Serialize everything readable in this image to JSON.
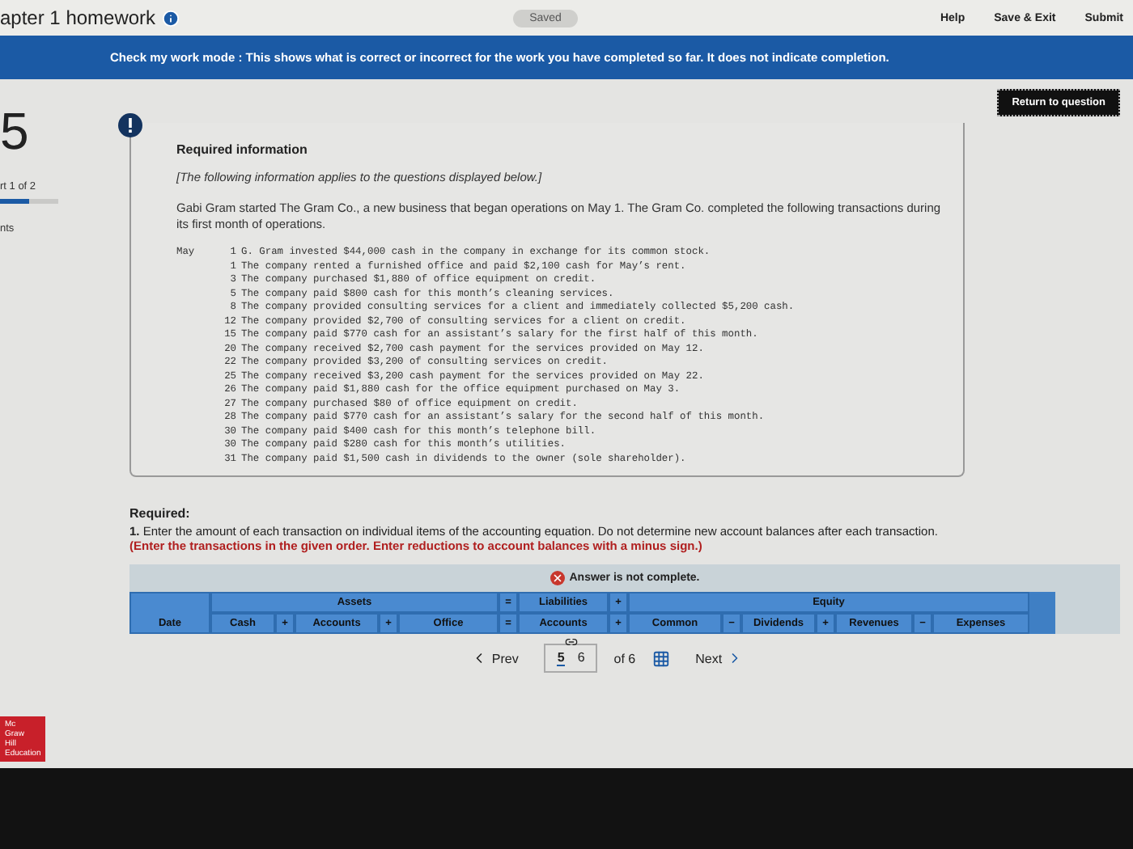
{
  "top_bar": {
    "title": "apter 1 homework",
    "status": "Saved",
    "links": [
      "Help",
      "Save & Exit",
      "Submit"
    ]
  },
  "banner": {
    "label": "Check my work mode :",
    "text": "This shows what is correct or incorrect for the work you have completed so far. It does not indicate completion."
  },
  "sidebar": {
    "question_number": "5",
    "part": "rt 1 of 2",
    "progress": {
      "level": 0.5
    },
    "points": "nts"
  },
  "return_button": "Return to question",
  "required_info": {
    "title": "Required information",
    "note": "[The following information applies to the questions displayed below.]",
    "intro": "Gabi Gram started The Gram Co., a new business that began operations on May 1. The Gram Co. completed the following transactions during its first month of operations.",
    "month": "May",
    "transactions": [
      {
        "day": "1",
        "text": "G. Gram invested $44,000 cash in the company in exchange for its common stock."
      },
      {
        "day": "1",
        "text": "The company rented a furnished office and paid $2,100 cash for May’s rent."
      },
      {
        "day": "3",
        "text": "The company purchased $1,880 of office equipment on credit."
      },
      {
        "day": "5",
        "text": "The company paid $800 cash for this month’s cleaning services."
      },
      {
        "day": "8",
        "text": "The company provided consulting services for a client and immediately collected $5,200 cash."
      },
      {
        "day": "12",
        "text": "The company provided $2,700 of consulting services for a client on credit."
      },
      {
        "day": "15",
        "text": "The company paid $770 cash for an assistant’s salary for the first half of this month."
      },
      {
        "day": "20",
        "text": "The company received $2,700 cash payment for the services provided on May 12."
      },
      {
        "day": "22",
        "text": "The company provided $3,200 of consulting services on credit."
      },
      {
        "day": "25",
        "text": "The company received $3,200 cash payment for the services provided on May 22."
      },
      {
        "day": "26",
        "text": "The company paid $1,880 cash for the office equipment purchased on May 3."
      },
      {
        "day": "27",
        "text": "The company purchased $80 of office equipment on credit."
      },
      {
        "day": "28",
        "text": "The company paid $770 cash for an assistant’s salary for the second half of this month."
      },
      {
        "day": "30",
        "text": "The company paid $400 cash for this month’s telephone bill."
      },
      {
        "day": "30",
        "text": "The company paid $280 cash for this month’s utilities."
      },
      {
        "day": "31",
        "text": "The company paid $1,500 cash in dividends to the owner (sole shareholder)."
      }
    ]
  },
  "required": {
    "title": "Required:",
    "text": "**1.** Enter the amount of each transaction on individual items of the accounting equation. Do not determine new account balances after each transaction.",
    "emphasis": "(Enter the transactions in the given order. Enter reductions to account balances with a minus sign.)"
  },
  "answer_status": "Answer is not complete.",
  "table": {
    "groups": [
      "Assets",
      "=",
      "Liabilities",
      "+",
      "Equity"
    ],
    "date_column": "Date",
    "columns": [
      "Cash",
      "+",
      "Accounts",
      "+",
      "Office",
      "=",
      "Accounts",
      "+",
      "Common",
      "−",
      "Dividends",
      "+",
      "Revenues",
      "−",
      "Expenses"
    ]
  },
  "pagination": {
    "prev": "Prev",
    "pages": [
      {
        "label": "5",
        "selected": true
      },
      {
        "label": "6",
        "selected": false
      }
    ],
    "total": "of 6",
    "next": "Next"
  },
  "logo": [
    "Mc",
    "Graw",
    "Hill",
    "Education"
  ]
}
